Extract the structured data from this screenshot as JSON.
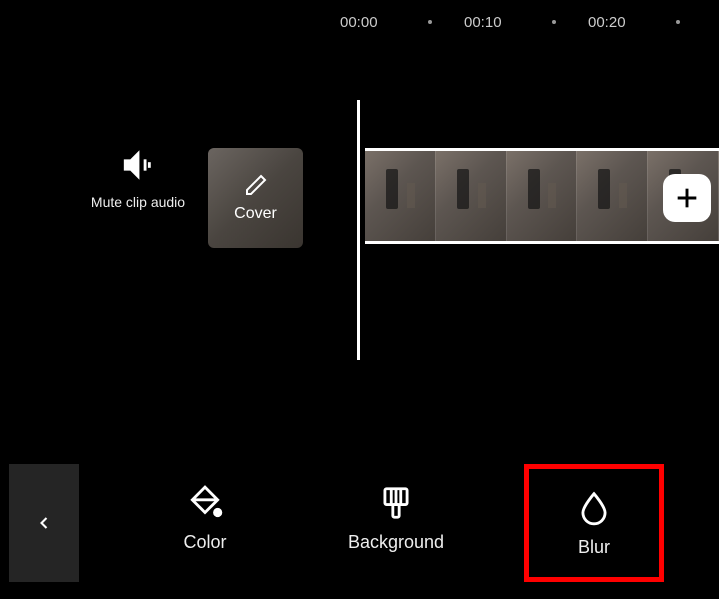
{
  "ruler": {
    "t0": "00:00",
    "t1": "00:10",
    "t2": "00:20"
  },
  "timeline": {
    "mute_label": "Mute clip audio",
    "cover_label": "Cover"
  },
  "tools": {
    "color_label": "Color",
    "background_label": "Background",
    "blur_label": "Blur"
  }
}
